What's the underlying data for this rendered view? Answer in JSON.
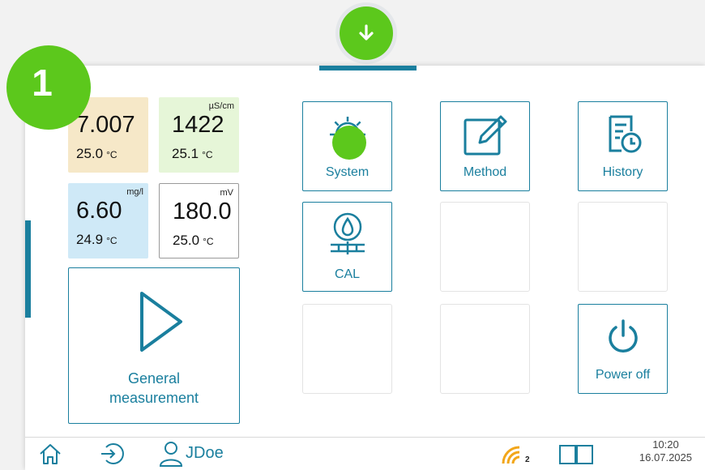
{
  "colors": {
    "accent": "#1a7f9e",
    "highlight": "#5cc81c"
  },
  "step_badge": "1",
  "readings": [
    {
      "unit": "",
      "value": "7.007",
      "temp": "25.0",
      "temp_unit": "°C",
      "color": "#f6e8c8"
    },
    {
      "unit": "µS/cm",
      "value": "1422",
      "temp": "25.1",
      "temp_unit": "°C",
      "color": "#e6f6d8"
    },
    {
      "unit": "mg/l",
      "value": "6.60",
      "temp": "24.9",
      "temp_unit": "°C",
      "color": "#cfe9f7"
    },
    {
      "unit": "mV",
      "value": "180.0",
      "temp": "25.0",
      "temp_unit": "°C",
      "color": "#ffffff"
    }
  ],
  "general_measurement": {
    "line1": "General",
    "line2": "measurement",
    "icon": "play-icon"
  },
  "menu": {
    "system": {
      "label": "System",
      "icon": "gear-icon"
    },
    "method": {
      "label": "Method",
      "icon": "edit-icon"
    },
    "history": {
      "label": "History",
      "icon": "history-icon"
    },
    "cal": {
      "label": "CAL",
      "icon": "calibration-icon"
    },
    "power": {
      "label": "Power off",
      "icon": "power-icon"
    }
  },
  "status_bar": {
    "user": "JDoe",
    "wifi_count": "2",
    "time": "10:20",
    "date": "16.07.2025"
  }
}
